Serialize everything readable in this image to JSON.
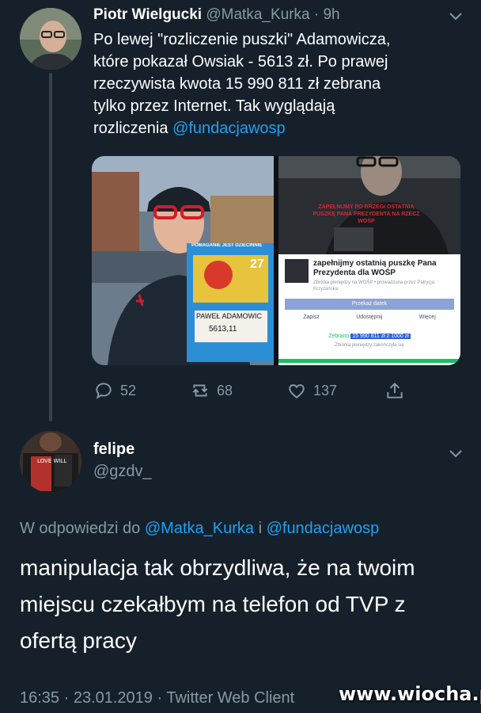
{
  "tweet": {
    "display_name": "Piotr Wielgucki",
    "handle": "@Matka_Kurka",
    "time": "9h",
    "text_lines": [
      "Po lewej \"rozliczenie puszki\" Adamowicza,",
      "które pokazał Owsiak - 5613 zł. Po prawej",
      "rzeczywista kwota 15 990 811 zł zebrana",
      "tylko przez Internet. Tak wyglądają"
    ],
    "text_last_prefix": "rozliczenia ",
    "text_mention": "@fundacjawosp",
    "media": {
      "left_sign_top": "POMAGANIE JEST DZIECINNIE",
      "left_sign_name": "PAWEŁ ADAMOWIC",
      "left_sign_amount": "5613,11",
      "left_sign_badge": "27",
      "right_overlay_text": "ZAPEŁNIJMY PO BRZEGI OSTATNIĄ PUSZKĘ PANA PREZYDENTA NA RZECZ WOŚP",
      "right_card_title": "zapełnijmy ostatnią puszkę Pana Prezydenta dla WOŚP",
      "right_card_sub": "Zbiórka pieniędzy na WOŚP • prowadzona przez Patrycja Krzyżańska",
      "right_card_button": "Przekaż datek",
      "right_card_save": "Zapisz",
      "right_card_share": "Udostępnij",
      "right_card_more": "Więcej",
      "right_card_raised_label": "Zebrano",
      "right_card_raised_amount": "15 990 811 zł z 1000 zł",
      "right_card_closed": "Zbiórka pieniędzy zakończyła się"
    },
    "actions": {
      "replies": "52",
      "retweets": "68",
      "likes": "137"
    }
  },
  "reply": {
    "display_name": "felipe",
    "handle": "@gzdv_",
    "in_reply_prefix": "W odpowiedzi do ",
    "in_reply_user1": "@Matka_Kurka",
    "in_reply_and": " i ",
    "in_reply_user2": "@fundacjawosp",
    "text_lines": [
      "manipulacja tak obrzydliwa, że na twoim",
      "miejscu czekałbym na telefon od TVP z",
      "ofertą pracy"
    ],
    "footer": "16:35 · 23.01.2019 · Twitter Web Client"
  },
  "watermark": "www.wiocha.pl",
  "colors": {
    "background": "#15202b",
    "link": "#1da1f2",
    "muted": "#8899a6",
    "progress": "#17bf63"
  },
  "icons": [
    "chevron-down-icon",
    "reply-icon",
    "retweet-icon",
    "like-icon",
    "share-icon"
  ]
}
